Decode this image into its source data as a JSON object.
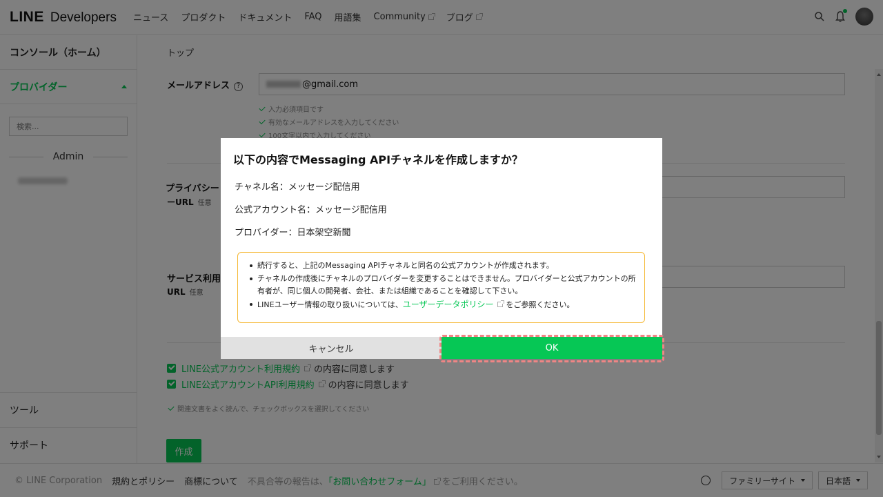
{
  "header": {
    "logo_line": "LINE",
    "logo_dev": "Developers",
    "nav": [
      "ニュース",
      "プロダクト",
      "ドキュメント",
      "FAQ",
      "用語集",
      "Community",
      "ブログ"
    ]
  },
  "sidebar": {
    "home": "コンソール（ホーム）",
    "provider": "プロバイダー",
    "search_placeholder": "検索...",
    "admin": "Admin",
    "tool": "ツール",
    "support": "サポート"
  },
  "main": {
    "breadcrumb": "トップ",
    "email_label": "メールアドレス",
    "email_value": "@gmail.com",
    "hints": [
      "入力必須項目です",
      "有効なメールアドレスを入力してください",
      "100文字以内で入力してください"
    ],
    "privacy_label_1": "プライバシー",
    "privacy_label_2": "ーURL",
    "service_label_1": "サービス利用",
    "service_label_2": "URL",
    "optional": "任意",
    "agree1_link": "LINE公式アカウント利用規約",
    "agree1_text": "の内容に同意します",
    "agree2_link": "LINE公式アカウントAPI利用規約",
    "agree2_text": "の内容に同意します",
    "agree_hint": "関連文書をよく読んで、チェックボックスを選択してください",
    "create_button": "作成"
  },
  "footer": {
    "copyright": "© LINE Corporation",
    "terms": "規約とポリシー",
    "trademark": "商標について",
    "notice_prefix": "不具合等の報告は、",
    "contact_link": "「お問い合わせフォーム」",
    "notice_suffix": "をご利用ください。",
    "family_site": "ファミリーサイト",
    "language": "日本語"
  },
  "modal": {
    "title": "以下の内容でMessaging APIチャネルを作成しますか？",
    "channel_name": "チャネル名：メッセージ配信用",
    "account_name": "公式アカウント名：メッセージ配信用",
    "provider": "プロバイダー：日本架空新聞",
    "notice_1": "続行すると、上記のMessaging APIチャネルと同名の公式アカウントが作成されます。",
    "notice_2": "チャネルの作成後にチャネルのプロバイダーを変更することはできません。プロバイダーと公式アカウントの所有者が、同じ個人の開発者、会社、または組織であることを確認して下さい。",
    "notice_3_prefix": "LINEユーザー情報の取り扱いについては、",
    "notice_3_link": "ユーザーデータポリシー",
    "notice_3_suffix": "をご参照ください。",
    "cancel_button": "キャンセル",
    "ok_button": "OK"
  },
  "colors": {
    "brand_green": "#06c755",
    "notice_border": "#f5b731",
    "highlight": "#f08585"
  }
}
